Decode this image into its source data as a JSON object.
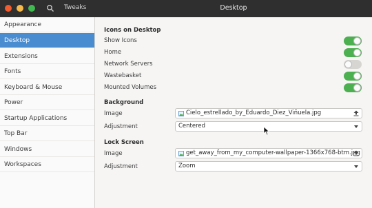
{
  "window": {
    "app_title": "Tweaks",
    "page_title": "Desktop",
    "colors": {
      "close": "#ee5c2f",
      "minimize": "#f6b94b",
      "maximize": "#3fb950",
      "accent": "#4a8cd0",
      "toggle_on": "#4caf50"
    }
  },
  "sidebar": {
    "items": [
      {
        "label": "Appearance"
      },
      {
        "label": "Desktop"
      },
      {
        "label": "Extensions"
      },
      {
        "label": "Fonts"
      },
      {
        "label": "Keyboard & Mouse"
      },
      {
        "label": "Power"
      },
      {
        "label": "Startup Applications"
      },
      {
        "label": "Top Bar"
      },
      {
        "label": "Windows"
      },
      {
        "label": "Workspaces"
      }
    ],
    "active": "Desktop"
  },
  "icons_on_desktop": {
    "heading": "Icons on Desktop",
    "rows": [
      {
        "label": "Show Icons",
        "enabled": true
      },
      {
        "label": "Home",
        "enabled": true
      },
      {
        "label": "Network Servers",
        "enabled": false
      },
      {
        "label": "Wastebasket",
        "enabled": true
      },
      {
        "label": "Mounted Volumes",
        "enabled": true
      }
    ]
  },
  "background": {
    "heading": "Background",
    "image_label": "Image",
    "image_file": "Cielo_estrellado_by_Eduardo_Diez_Viñuela.jpg",
    "adjustment_label": "Adjustment",
    "adjustment_value": "Centered"
  },
  "lock_screen": {
    "heading": "Lock Screen",
    "image_label": "Image",
    "image_file": "get_away_from_my_computer-wallpaper-1366x768-btm.jpg",
    "adjustment_label": "Adjustment",
    "adjustment_value": "Zoom"
  }
}
